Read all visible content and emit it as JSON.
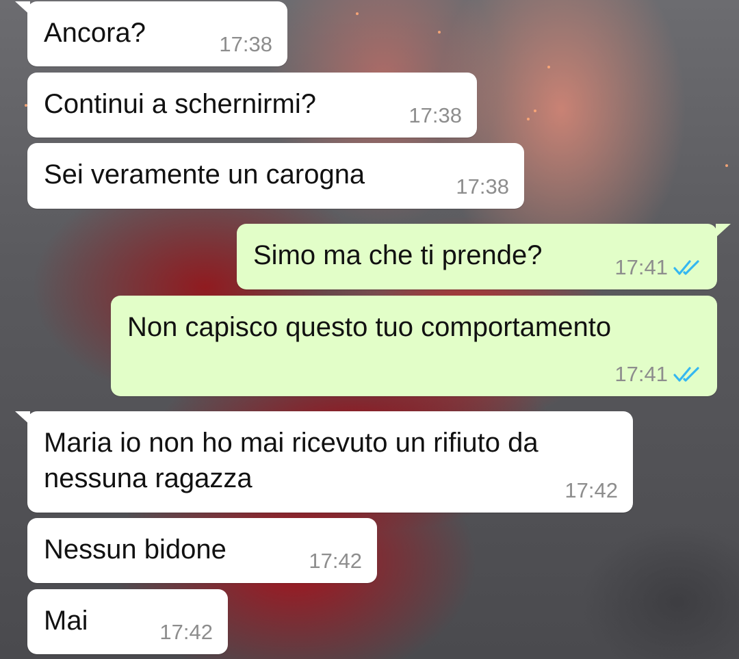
{
  "chat": {
    "messages": [
      {
        "direction": "incoming",
        "text": "Ancora?",
        "time": "17:38"
      },
      {
        "direction": "incoming",
        "text": "Continui a schernirmi?",
        "time": "17:38"
      },
      {
        "direction": "incoming",
        "text": "Sei veramente un carogna",
        "time": "17:38"
      },
      {
        "direction": "outgoing",
        "text": "Simo ma che ti prende?",
        "time": "17:41",
        "status": "read"
      },
      {
        "direction": "outgoing",
        "text": "Non capisco questo tuo comportamento",
        "time": "17:41",
        "status": "read"
      },
      {
        "direction": "incoming",
        "text": "Maria io non ho mai ricevuto un rifiuto da nessuna ragazza",
        "time": "17:42"
      },
      {
        "direction": "incoming",
        "text": "Nessun bidone",
        "time": "17:42"
      },
      {
        "direction": "incoming",
        "text": "Mai",
        "time": "17:42"
      }
    ]
  },
  "colors": {
    "incoming_bubble": "#ffffff",
    "outgoing_bubble": "#e2fec8",
    "timestamp": "#8d8d8d",
    "read_ticks": "#34b7f1"
  },
  "icons": {
    "read_receipt": "double-check-icon",
    "wallpaper": "red-rose-flame-wallpaper"
  }
}
